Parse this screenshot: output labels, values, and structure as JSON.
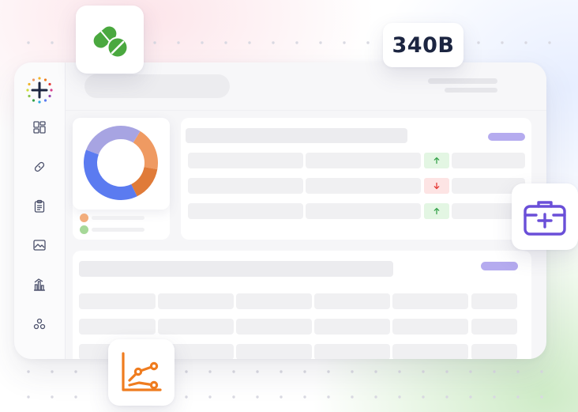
{
  "badge_text": "340B",
  "icons": {
    "pill": "pill-icon",
    "medical_kit": "medical-kit-icon",
    "scatter_chart": "scatter-chart-icon",
    "logo": "plus-logo-icon",
    "sidebar": [
      "dashboard-icon",
      "bandage-icon",
      "clipboard-icon",
      "image-chart-icon",
      "bar-chart-icon",
      "network-icon"
    ]
  },
  "trend_rows": [
    "up",
    "down",
    "up"
  ],
  "donut": {
    "segments": [
      {
        "color": "#ef9a62",
        "value": 0.19
      },
      {
        "color": "#e07b39",
        "value": 0.15
      },
      {
        "color": "#5b7bf0",
        "value": 0.38
      },
      {
        "color": "#a7a4e2",
        "value": 0.28
      }
    ]
  },
  "colors": {
    "accent": "#b5abef",
    "up": "#35a24a",
    "down": "#e53935",
    "pill": "#4aa83f",
    "kit": "#6a4fd8",
    "chart": "#ef7c1f",
    "badge_text": "#1c2541",
    "legend_orange": "#f2ad7c",
    "legend_green": "#a6d898"
  }
}
